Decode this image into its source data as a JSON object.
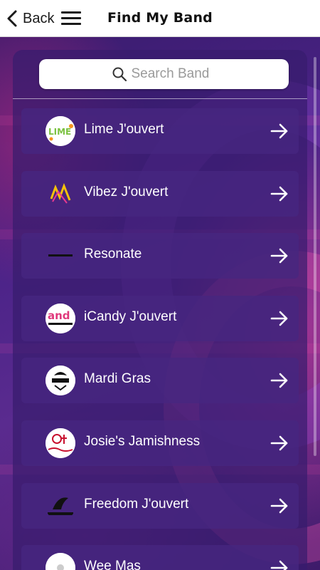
{
  "header": {
    "back_label": "Back",
    "title": "Find My Band"
  },
  "search": {
    "placeholder": "Search Band"
  },
  "bands": [
    {
      "name": "Lime J'ouvert",
      "logo_text": "LIME",
      "icon": "lime-logo-icon"
    },
    {
      "name": "Vibez J'ouvert",
      "logo_text": "",
      "icon": "vibez-logo-icon"
    },
    {
      "name": "Resonate",
      "logo_text": "",
      "icon": "resonate-logo-icon"
    },
    {
      "name": "iCandy J'ouvert",
      "logo_text": "and",
      "icon": "icandy-logo-icon"
    },
    {
      "name": "Mardi Gras",
      "logo_text": "",
      "icon": "mardi-gras-logo-icon"
    },
    {
      "name": "Josie's Jamishness",
      "logo_text": "",
      "icon": "josies-logo-icon"
    },
    {
      "name": "Freedom J'ouvert",
      "logo_text": "",
      "icon": "freedom-logo-icon"
    },
    {
      "name": "Wee Mas",
      "logo_text": "",
      "icon": "wee-mas-logo-icon"
    }
  ],
  "colors": {
    "header_bg": "#ffffff",
    "panel_bg": "#381c6e",
    "row_bg": "#46267f",
    "text": "#ffffff"
  }
}
